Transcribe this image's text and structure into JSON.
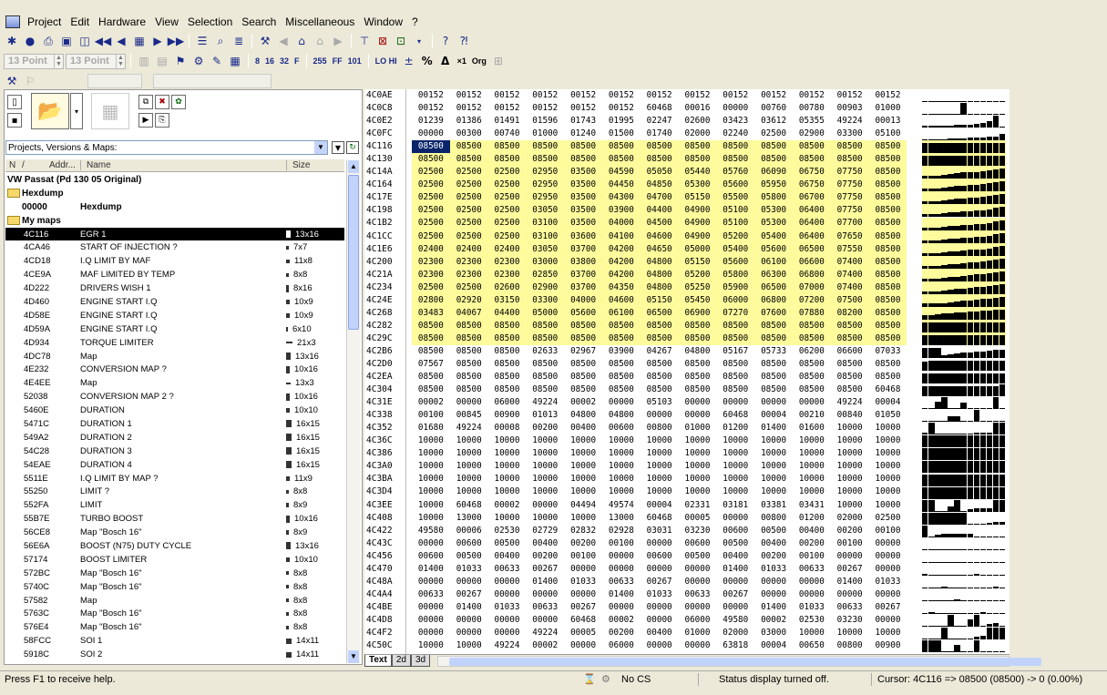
{
  "menu": [
    "Project",
    "Edit",
    "Hardware",
    "View",
    "Selection",
    "Search",
    "Miscellaneous",
    "Window",
    "?"
  ],
  "toolbar2": {
    "font1": "13 Point",
    "font2": "13 Point",
    "percent_icon": "%",
    "delta_icon": "Δ",
    "x1": "×1",
    "org": "Org"
  },
  "left_panel": {
    "combo_label": "Projects, Versions & Maps:",
    "col_headers": {
      "n": "N",
      "slash": "/",
      "addr": "Addr...",
      "name": "Name",
      "size": "Size"
    },
    "project_title": "VW Passat (Pd 130 05 Original)",
    "hexdump_group": "Hexdump",
    "hexdump_addr": "00000",
    "hexdump_name": "Hexdump",
    "mymaps_group": "My maps",
    "maps": [
      {
        "addr": "4C116",
        "name": "EGR 1",
        "size": "13x16",
        "sel": true
      },
      {
        "addr": "4CA46",
        "name": "START OF INJECTION ?",
        "size": "7x7"
      },
      {
        "addr": "4CD18",
        "name": "I.Q LIMIT BY MAF",
        "size": "11x8"
      },
      {
        "addr": "4CE9A",
        "name": "MAF LIMITED BY TEMP",
        "size": "8x8"
      },
      {
        "addr": "4D222",
        "name": "DRIVERS WISH 1",
        "size": "8x16"
      },
      {
        "addr": "4D460",
        "name": "ENGINE START I.Q",
        "size": "10x9"
      },
      {
        "addr": "4D58E",
        "name": "ENGINE START I.Q",
        "size": "10x9"
      },
      {
        "addr": "4D59A",
        "name": "ENGINE START I.Q",
        "size": "6x10"
      },
      {
        "addr": "4D934",
        "name": "TORQUE LIMITER",
        "size": "21x3"
      },
      {
        "addr": "4DC78",
        "name": "Map",
        "size": "13x16"
      },
      {
        "addr": "4E232",
        "name": "CONVERSION MAP ?",
        "size": "10x16"
      },
      {
        "addr": "4E4EE",
        "name": "Map",
        "size": "13x3"
      },
      {
        "addr": "52038",
        "name": "CONVERSION MAP 2 ?",
        "size": "10x16"
      },
      {
        "addr": "5460E",
        "name": "DURATION",
        "size": "10x10"
      },
      {
        "addr": "5471C",
        "name": "DURATION 1",
        "size": "16x15"
      },
      {
        "addr": "549A2",
        "name": "DURATION 2",
        "size": "16x15"
      },
      {
        "addr": "54C28",
        "name": "DURATION 3",
        "size": "16x15"
      },
      {
        "addr": "54EAE",
        "name": "DURATION 4",
        "size": "16x15"
      },
      {
        "addr": "5511E",
        "name": "I.Q LIMIT BY MAP ?",
        "size": "11x9"
      },
      {
        "addr": "55250",
        "name": "LIMIT ?",
        "size": "8x8"
      },
      {
        "addr": "552FA",
        "name": "LIMIT",
        "size": "8x9"
      },
      {
        "addr": "55B7E",
        "name": "TURBO BOOST",
        "size": "10x16"
      },
      {
        "addr": "56CE8",
        "name": "Map \"Bosch 16\"",
        "size": "8x9"
      },
      {
        "addr": "56E6A",
        "name": "BOOST (N75) DUTY CYCLE",
        "size": "13x16"
      },
      {
        "addr": "57174",
        "name": "BOOST LIMITER",
        "size": "10x10"
      },
      {
        "addr": "572BC",
        "name": "Map \"Bosch 16\"",
        "size": "8x8"
      },
      {
        "addr": "5740C",
        "name": "Map \"Bosch 16\"",
        "size": "8x8"
      },
      {
        "addr": "57582",
        "name": "Map",
        "size": "8x8"
      },
      {
        "addr": "5763C",
        "name": "Map \"Bosch 16\"",
        "size": "8x8"
      },
      {
        "addr": "576E4",
        "name": "Map \"Bosch 16\"",
        "size": "8x8"
      },
      {
        "addr": "58FCC",
        "name": "SOI 1",
        "size": "14x11"
      },
      {
        "addr": "5918C",
        "name": "SOI 2",
        "size": "14x11"
      }
    ]
  },
  "hex": {
    "rows": [
      {
        "a": "4C0AE",
        "v": [
          "00152",
          "00152",
          "00152",
          "00152",
          "00152",
          "00152",
          "00152",
          "00152",
          "00152",
          "00152",
          "00152",
          "00152",
          "00152"
        ]
      },
      {
        "a": "4C0C8",
        "v": [
          "00152",
          "00152",
          "00152",
          "00152",
          "00152",
          "00152",
          "60468",
          "00016",
          "00000",
          "00760",
          "00780",
          "00903",
          "01000"
        ]
      },
      {
        "a": "4C0E2",
        "v": [
          "01239",
          "01386",
          "01491",
          "01596",
          "01743",
          "01995",
          "02247",
          "02600",
          "03423",
          "03612",
          "05355",
          "49224",
          "00013"
        ]
      },
      {
        "a": "4C0FC",
        "v": [
          "00000",
          "00300",
          "00740",
          "01000",
          "01240",
          "01500",
          "01740",
          "02000",
          "02240",
          "02500",
          "02900",
          "03300",
          "05100"
        ]
      },
      {
        "a": "4C116",
        "v": [
          "08500",
          "08500",
          "08500",
          "08500",
          "08500",
          "08500",
          "08500",
          "08500",
          "08500",
          "08500",
          "08500",
          "08500",
          "08500"
        ],
        "y": true
      },
      {
        "a": "4C130",
        "v": [
          "08500",
          "08500",
          "08500",
          "08500",
          "08500",
          "08500",
          "08500",
          "08500",
          "08500",
          "08500",
          "08500",
          "08500",
          "08500"
        ],
        "y": true
      },
      {
        "a": "4C14A",
        "v": [
          "02500",
          "02500",
          "02500",
          "02950",
          "03500",
          "04590",
          "05050",
          "05440",
          "05760",
          "06090",
          "06750",
          "07750",
          "08500"
        ],
        "y": true
      },
      {
        "a": "4C164",
        "v": [
          "02500",
          "02500",
          "02500",
          "02950",
          "03500",
          "04450",
          "04850",
          "05300",
          "05600",
          "05950",
          "06750",
          "07750",
          "08500"
        ],
        "y": true
      },
      {
        "a": "4C17E",
        "v": [
          "02500",
          "02500",
          "02500",
          "02950",
          "03500",
          "04300",
          "04700",
          "05150",
          "05500",
          "05800",
          "06700",
          "07750",
          "08500"
        ],
        "y": true
      },
      {
        "a": "4C198",
        "v": [
          "02500",
          "02500",
          "02500",
          "03050",
          "03500",
          "03900",
          "04400",
          "04900",
          "05100",
          "05300",
          "06400",
          "07750",
          "08500"
        ],
        "y": true
      },
      {
        "a": "4C1B2",
        "v": [
          "02500",
          "02500",
          "02500",
          "03100",
          "03500",
          "04000",
          "04500",
          "04900",
          "05100",
          "05300",
          "06400",
          "07700",
          "08500"
        ],
        "y": true
      },
      {
        "a": "4C1CC",
        "v": [
          "02500",
          "02500",
          "02500",
          "03100",
          "03600",
          "04100",
          "04600",
          "04900",
          "05200",
          "05400",
          "06400",
          "07650",
          "08500"
        ],
        "y": true
      },
      {
        "a": "4C1E6",
        "v": [
          "02400",
          "02400",
          "02400",
          "03050",
          "03700",
          "04200",
          "04650",
          "05000",
          "05400",
          "05600",
          "06500",
          "07550",
          "08500"
        ],
        "y": true
      },
      {
        "a": "4C200",
        "v": [
          "02300",
          "02300",
          "02300",
          "03000",
          "03800",
          "04200",
          "04800",
          "05150",
          "05600",
          "06100",
          "06600",
          "07400",
          "08500"
        ],
        "y": true
      },
      {
        "a": "4C21A",
        "v": [
          "02300",
          "02300",
          "02300",
          "02850",
          "03700",
          "04200",
          "04800",
          "05200",
          "05800",
          "06300",
          "06800",
          "07400",
          "08500"
        ],
        "y": true
      },
      {
        "a": "4C234",
        "v": [
          "02500",
          "02500",
          "02600",
          "02900",
          "03700",
          "04350",
          "04800",
          "05250",
          "05900",
          "06500",
          "07000",
          "07400",
          "08500"
        ],
        "y": true
      },
      {
        "a": "4C24E",
        "v": [
          "02800",
          "02920",
          "03150",
          "03300",
          "04000",
          "04600",
          "05150",
          "05450",
          "06000",
          "06800",
          "07200",
          "07500",
          "08500"
        ],
        "y": true
      },
      {
        "a": "4C268",
        "v": [
          "03483",
          "04067",
          "04400",
          "05000",
          "05600",
          "06100",
          "06500",
          "06900",
          "07270",
          "07600",
          "07880",
          "08200",
          "08500"
        ],
        "y": true
      },
      {
        "a": "4C282",
        "v": [
          "08500",
          "08500",
          "08500",
          "08500",
          "08500",
          "08500",
          "08500",
          "08500",
          "08500",
          "08500",
          "08500",
          "08500",
          "08500"
        ],
        "y": true
      },
      {
        "a": "4C29C",
        "v": [
          "08500",
          "08500",
          "08500",
          "08500",
          "08500",
          "08500",
          "08500",
          "08500",
          "08500",
          "08500",
          "08500",
          "08500",
          "08500"
        ],
        "y": true
      },
      {
        "a": "4C2B6",
        "v": [
          "08500",
          "08500",
          "08500",
          "02633",
          "02967",
          "03900",
          "04267",
          "04800",
          "05167",
          "05733",
          "06200",
          "06600",
          "07033"
        ]
      },
      {
        "a": "4C2D0",
        "v": [
          "07567",
          "08500",
          "08500",
          "08500",
          "08500",
          "08500",
          "08500",
          "08500",
          "08500",
          "08500",
          "08500",
          "08500",
          "08500"
        ]
      },
      {
        "a": "4C2EA",
        "v": [
          "08500",
          "08500",
          "08500",
          "08500",
          "08500",
          "08500",
          "08500",
          "08500",
          "08500",
          "08500",
          "08500",
          "08500",
          "08500"
        ]
      },
      {
        "a": "4C304",
        "v": [
          "08500",
          "08500",
          "08500",
          "08500",
          "08500",
          "08500",
          "08500",
          "08500",
          "08500",
          "08500",
          "08500",
          "08500",
          "60468"
        ]
      },
      {
        "a": "4C31E",
        "v": [
          "00002",
          "00000",
          "06000",
          "49224",
          "00002",
          "00000",
          "05103",
          "00000",
          "00000",
          "00000",
          "00000",
          "49224",
          "00004"
        ]
      },
      {
        "a": "4C338",
        "v": [
          "00100",
          "00845",
          "00900",
          "01013",
          "04800",
          "04800",
          "00000",
          "00000",
          "60468",
          "00004",
          "00210",
          "00840",
          "01050"
        ]
      },
      {
        "a": "4C352",
        "v": [
          "01680",
          "49224",
          "00008",
          "00200",
          "00400",
          "00600",
          "00800",
          "01000",
          "01200",
          "01400",
          "01600",
          "10000",
          "10000"
        ]
      },
      {
        "a": "4C36C",
        "v": [
          "10000",
          "10000",
          "10000",
          "10000",
          "10000",
          "10000",
          "10000",
          "10000",
          "10000",
          "10000",
          "10000",
          "10000",
          "10000"
        ]
      },
      {
        "a": "4C386",
        "v": [
          "10000",
          "10000",
          "10000",
          "10000",
          "10000",
          "10000",
          "10000",
          "10000",
          "10000",
          "10000",
          "10000",
          "10000",
          "10000"
        ]
      },
      {
        "a": "4C3A0",
        "v": [
          "10000",
          "10000",
          "10000",
          "10000",
          "10000",
          "10000",
          "10000",
          "10000",
          "10000",
          "10000",
          "10000",
          "10000",
          "10000"
        ]
      },
      {
        "a": "4C3BA",
        "v": [
          "10000",
          "10000",
          "10000",
          "10000",
          "10000",
          "10000",
          "10000",
          "10000",
          "10000",
          "10000",
          "10000",
          "10000",
          "10000"
        ]
      },
      {
        "a": "4C3D4",
        "v": [
          "10000",
          "10000",
          "10000",
          "10000",
          "10000",
          "10000",
          "10000",
          "10000",
          "10000",
          "10000",
          "10000",
          "10000",
          "10000"
        ]
      },
      {
        "a": "4C3EE",
        "v": [
          "10000",
          "60468",
          "00002",
          "00000",
          "04494",
          "49574",
          "00004",
          "02331",
          "03181",
          "03381",
          "03431",
          "10000",
          "10000"
        ]
      },
      {
        "a": "4C408",
        "v": [
          "10000",
          "13000",
          "10000",
          "10000",
          "10000",
          "13000",
          "60468",
          "00005",
          "00000",
          "00800",
          "01200",
          "02000",
          "02500"
        ]
      },
      {
        "a": "4C422",
        "v": [
          "49580",
          "00006",
          "02530",
          "02729",
          "02832",
          "02928",
          "03031",
          "03230",
          "00600",
          "00500",
          "00400",
          "00200",
          "00100"
        ]
      },
      {
        "a": "4C43C",
        "v": [
          "00000",
          "00600",
          "00500",
          "00400",
          "00200",
          "00100",
          "00000",
          "00600",
          "00500",
          "00400",
          "00200",
          "00100",
          "00000"
        ]
      },
      {
        "a": "4C456",
        "v": [
          "00600",
          "00500",
          "00400",
          "00200",
          "00100",
          "00000",
          "00600",
          "00500",
          "00400",
          "00200",
          "00100",
          "00000",
          "00000"
        ]
      },
      {
        "a": "4C470",
        "v": [
          "01400",
          "01033",
          "00633",
          "00267",
          "00000",
          "00000",
          "00000",
          "00000",
          "01400",
          "01033",
          "00633",
          "00267",
          "00000"
        ]
      },
      {
        "a": "4C48A",
        "v": [
          "00000",
          "00000",
          "00000",
          "01400",
          "01033",
          "00633",
          "00267",
          "00000",
          "00000",
          "00000",
          "00000",
          "01400",
          "01033"
        ]
      },
      {
        "a": "4C4A4",
        "v": [
          "00633",
          "00267",
          "00000",
          "00000",
          "00000",
          "01400",
          "01033",
          "00633",
          "00267",
          "00000",
          "00000",
          "00000",
          "00000"
        ]
      },
      {
        "a": "4C4BE",
        "v": [
          "00000",
          "01400",
          "01033",
          "00633",
          "00267",
          "00000",
          "00000",
          "00000",
          "00000",
          "01400",
          "01033",
          "00633",
          "00267"
        ]
      },
      {
        "a": "4C4D8",
        "v": [
          "00000",
          "00000",
          "00000",
          "00000",
          "60468",
          "00002",
          "00000",
          "06000",
          "49580",
          "00002",
          "02530",
          "03230",
          "00000"
        ]
      },
      {
        "a": "4C4F2",
        "v": [
          "00000",
          "00000",
          "00000",
          "49224",
          "00005",
          "00200",
          "00400",
          "01000",
          "02000",
          "03000",
          "10000",
          "10000",
          "10000"
        ]
      },
      {
        "a": "4C50C",
        "v": [
          "10000",
          "10000",
          "49224",
          "00002",
          "00000",
          "06000",
          "00000",
          "00000",
          "63818",
          "00004",
          "00650",
          "00800",
          "00900"
        ]
      }
    ]
  },
  "tabs": [
    "Text",
    "2d",
    "3d"
  ],
  "status": {
    "help": "Press F1 to receive help.",
    "cs": "No CS",
    "display": "Status display turned off.",
    "cursor": "Cursor: 4C116 => 08500 (08500) -> 0 (0.00%)"
  }
}
